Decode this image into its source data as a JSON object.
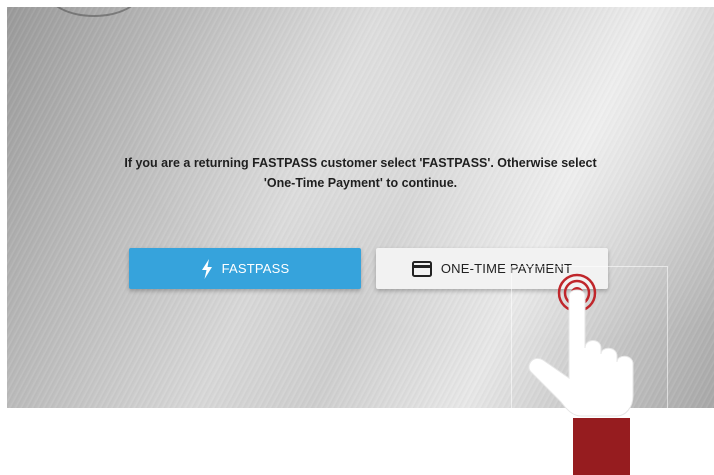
{
  "instruction": {
    "line1": "If you are a returning FASTPASS customer select 'FASTPASS'. Otherwise select",
    "line2": "'One-Time Payment' to continue."
  },
  "buttons": {
    "fastpass": {
      "label": "FASTPASS",
      "icon": "lightning-bolt-icon",
      "color": "#36a3dc"
    },
    "one_time_payment": {
      "label": "ONE-TIME PAYMENT",
      "icon": "credit-card-icon",
      "color": "#f2f2f2"
    }
  },
  "colors": {
    "hand_cuff": "#961c1f",
    "touch_ring": "#c0262b"
  }
}
